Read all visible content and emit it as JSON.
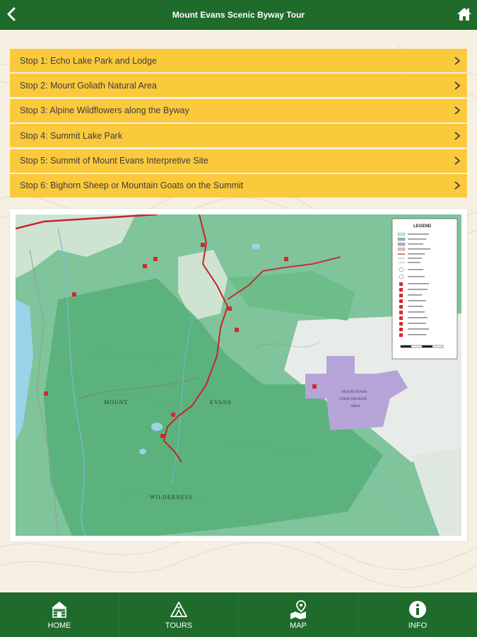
{
  "header": {
    "title": "Mount Evans Scenic Byway Tour"
  },
  "stops": [
    {
      "label": "Stop 1: Echo Lake Park and Lodge"
    },
    {
      "label": "Stop 2: Mount Goliath Natural Area"
    },
    {
      "label": "Stop 3: Alpine Wildflowers along the Byway"
    },
    {
      "label": "Stop 4: Summit Lake Park"
    },
    {
      "label": "Stop 5: Summit of Mount Evans Interpretive Site"
    },
    {
      "label": "Stop 6: Bighorn Sheep or Mountain Goats on the Summit"
    }
  ],
  "map": {
    "wilderness_words": [
      "MOUNT",
      "EVANS",
      "WILDERNESS"
    ],
    "park_label": [
      "MOUNT EVANS",
      "STATE WILDLIFE",
      "AREA"
    ],
    "legend_title": "LEGEND",
    "colors": {
      "forest": "#7fc49a",
      "wilderness_green": "#58b07a",
      "purple": "#b6a4d8",
      "route": "#c8232c",
      "water": "#9ad3e8"
    }
  },
  "bottom_nav": [
    {
      "label": "HOME",
      "icon": "cabin-icon"
    },
    {
      "label": "TOURS",
      "icon": "mountain-icon"
    },
    {
      "label": "MAP",
      "icon": "map-pin-icon"
    },
    {
      "label": "INFO",
      "icon": "info-icon"
    }
  ]
}
